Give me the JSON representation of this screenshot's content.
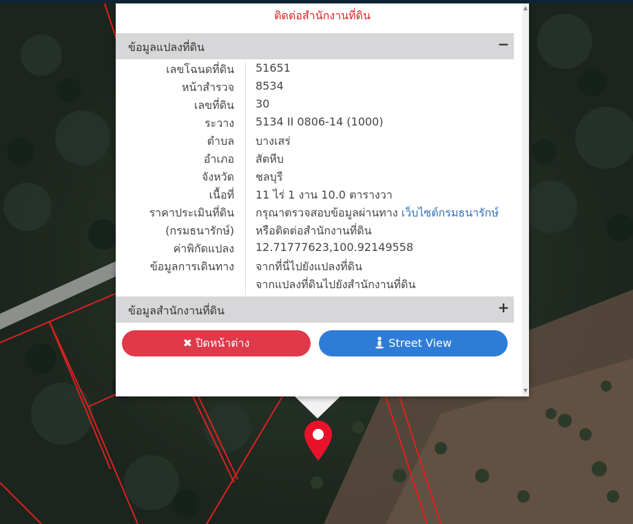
{
  "header": {
    "contact_text": "ติดต่อสำนักงานที่ดิน"
  },
  "parcel_section": {
    "title": "ข้อมูลแปลงที่ดิน",
    "toggle": "−",
    "rows": [
      {
        "label": "เลขโฉนดที่ดิน",
        "value": "51651"
      },
      {
        "label": "หน้าสำรวจ",
        "value": "8534"
      },
      {
        "label": "เลขที่ดิน",
        "value": "30"
      },
      {
        "label": "ระวาง",
        "value": "5134 II 0806-14 (1000)"
      },
      {
        "label": "ตำบล",
        "value": "บางเสร่"
      },
      {
        "label": "อำเภอ",
        "value": "สัตหีบ"
      },
      {
        "label": "จังหวัด",
        "value": "ชลบุรี"
      },
      {
        "label": "เนื้อที่",
        "value": "11 ไร่ 1 งาน 10.0 ตารางวา"
      }
    ],
    "appraisal": {
      "label_1": "ราคาประเมินที่ดิน",
      "label_2": "(กรมธนารักษ์)",
      "text_1": "กรุณาตรวจสอบข้อมูลผ่านทาง",
      "link": "เว็บไซต์กรมธนารักษ์",
      "text_2": "หรือติดต่อสำนักงานที่ดิน"
    },
    "coordinates": {
      "label": "ค่าพิกัดแปลง",
      "value": "12.71777623,100.92149558"
    },
    "travel": {
      "label": "ข้อมูลการเดินทาง",
      "link_1": "จากที่นี่ไปยังแปลงที่ดิน",
      "link_2": "จากแปลงที่ดินไปยังสำนักงานที่ดิน"
    }
  },
  "office_section": {
    "title": "ข้อมูลสำนักงานที่ดิน",
    "toggle": "+"
  },
  "buttons": {
    "close_icon": "✖",
    "close_label": "ปิดหน้าต่าง",
    "street_icon": "person-icon",
    "street_label": "Street View"
  },
  "colors": {
    "close_button": "#e0394a",
    "street_button": "#2e7cd8",
    "link": "#2f6fb6",
    "contact_text": "#e02020",
    "parcel_lines": "#e02020",
    "pin": "#e8132a"
  }
}
